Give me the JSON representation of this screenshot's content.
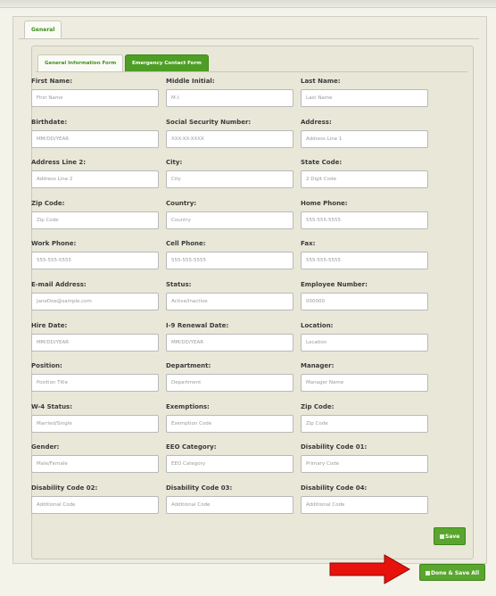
{
  "tabs": {
    "general": "General"
  },
  "inner_tabs": {
    "info": "General Information Form",
    "emergency": "Emergency Contact Form"
  },
  "fields": [
    {
      "label": "First Name:",
      "placeholder": "First Name"
    },
    {
      "label": "Middle Initial:",
      "placeholder": "M.I."
    },
    {
      "label": "Last Name:",
      "placeholder": "Last Name"
    },
    {
      "label": "Birthdate:",
      "placeholder": "MM/DD/YEAR"
    },
    {
      "label": "Social Security Number:",
      "placeholder": "XXX-XX-XXXX"
    },
    {
      "label": "Address:",
      "placeholder": "Address Line 1"
    },
    {
      "label": "Address Line 2:",
      "placeholder": "Address Line 2"
    },
    {
      "label": "City:",
      "placeholder": "City"
    },
    {
      "label": "State Code:",
      "placeholder": "2 Digit Code"
    },
    {
      "label": "Zip Code:",
      "placeholder": "Zip Code"
    },
    {
      "label": "Country:",
      "placeholder": "Country"
    },
    {
      "label": "Home Phone:",
      "placeholder": "555-555-5555"
    },
    {
      "label": "Work Phone:",
      "placeholder": "555-555-5555"
    },
    {
      "label": "Cell Phone:",
      "placeholder": "555-555-5555"
    },
    {
      "label": "Fax:",
      "placeholder": "555-555-5555"
    },
    {
      "label": "E-mail Address:",
      "placeholder": "JaneDoe@sample.com"
    },
    {
      "label": "Status:",
      "placeholder": "Active/Inactive"
    },
    {
      "label": "Employee Number:",
      "placeholder": "000000"
    },
    {
      "label": "Hire Date:",
      "placeholder": "MM/DD/YEAR"
    },
    {
      "label": "I-9 Renewal Date:",
      "placeholder": "MM/DD/YEAR"
    },
    {
      "label": "Location:",
      "placeholder": "Location"
    },
    {
      "label": "Position:",
      "placeholder": "Position Title"
    },
    {
      "label": "Department:",
      "placeholder": "Department"
    },
    {
      "label": "Manager:",
      "placeholder": "Manager Name"
    },
    {
      "label": "W-4 Status:",
      "placeholder": "Married/Single"
    },
    {
      "label": "Exemptions:",
      "placeholder": "Exemption Code"
    },
    {
      "label": "Zip Code:",
      "placeholder": "Zip Code"
    },
    {
      "label": "Gender:",
      "placeholder": "Male/Female"
    },
    {
      "label": "EEO Category:",
      "placeholder": "EEO Category"
    },
    {
      "label": "Disability Code 01:",
      "placeholder": "Primary Code"
    },
    {
      "label": "Disability Code 02:",
      "placeholder": "Additional Code"
    },
    {
      "label": "Disability Code 03:",
      "placeholder": "Additional Code"
    },
    {
      "label": "Disability Code 04:",
      "placeholder": "Additional Code"
    }
  ],
  "buttons": {
    "save": "Save",
    "done": "Done & Save All"
  },
  "icons": {
    "save": "save-icon",
    "done": "save-icon",
    "arrow": "red-arrow-right-icon"
  },
  "colors": {
    "accent": "#4e9e25",
    "arrow": "#e8120c"
  }
}
